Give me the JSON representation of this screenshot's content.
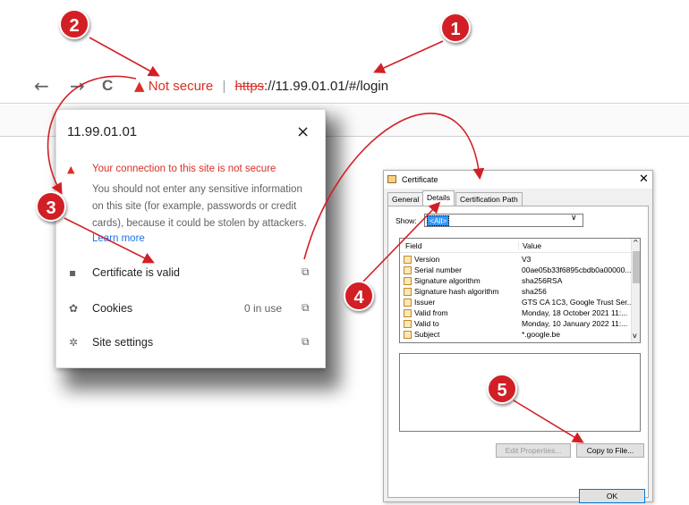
{
  "browser": {
    "back_icon": "←",
    "forward_icon": "→",
    "reload_icon": "C",
    "security_icon": "▲",
    "security_label": "Not secure",
    "separator": "|",
    "url_scheme": "https",
    "url_rest": "://11.99.01.01/#/login"
  },
  "site_popup": {
    "title": "11.99.01.01",
    "close_icon": "×",
    "warning_icon": "▲",
    "warning_title": "Your connection to this site is not secure",
    "warning_body": "You should not enter any sensitive information on this site (for example, passwords or credit cards), because it could be stolen by attackers.",
    "learn_more": "Learn more",
    "rows": [
      {
        "icon": "▪",
        "label": "Certificate is valid",
        "extra": "",
        "ext_icon": "⧉"
      },
      {
        "icon": "✿",
        "label": "Cookies",
        "extra": "0 in use",
        "ext_icon": "⧉"
      },
      {
        "icon": "✲",
        "label": "Site settings",
        "extra": "",
        "ext_icon": "⧉"
      }
    ]
  },
  "certificate": {
    "title": "Certificate",
    "close_icon": "✕",
    "tabs": [
      "General",
      "Details",
      "Certification Path"
    ],
    "active_tab": "Details",
    "show_label": "Show:",
    "show_value": "<All>",
    "dropdown_icon": "∨",
    "columns": {
      "field": "Field",
      "value": "Value"
    },
    "fields": [
      {
        "field": "Version",
        "value": "V3"
      },
      {
        "field": "Serial number",
        "value": "00ae05b33f6895cbdb0a00000..."
      },
      {
        "field": "Signature algorithm",
        "value": "sha256RSA"
      },
      {
        "field": "Signature hash algorithm",
        "value": "sha256"
      },
      {
        "field": "Issuer",
        "value": "GTS CA 1C3, Google Trust Ser..."
      },
      {
        "field": "Valid from",
        "value": "Monday, 18 October 2021 11:..."
      },
      {
        "field": "Valid to",
        "value": "Monday, 10 January 2022 11:..."
      },
      {
        "field": "Subject",
        "value": "*.google.be"
      }
    ],
    "scroll_up_icon": "^",
    "scroll_down_icon": "v",
    "edit_properties": "Edit Properties...",
    "copy_to_file": "Copy to File...",
    "ok": "OK"
  },
  "callouts": [
    "1",
    "2",
    "3",
    "4",
    "5"
  ],
  "colors": {
    "warning_red": "#d93025",
    "callout_red": "#d21f26",
    "link_blue": "#1a73e8"
  }
}
